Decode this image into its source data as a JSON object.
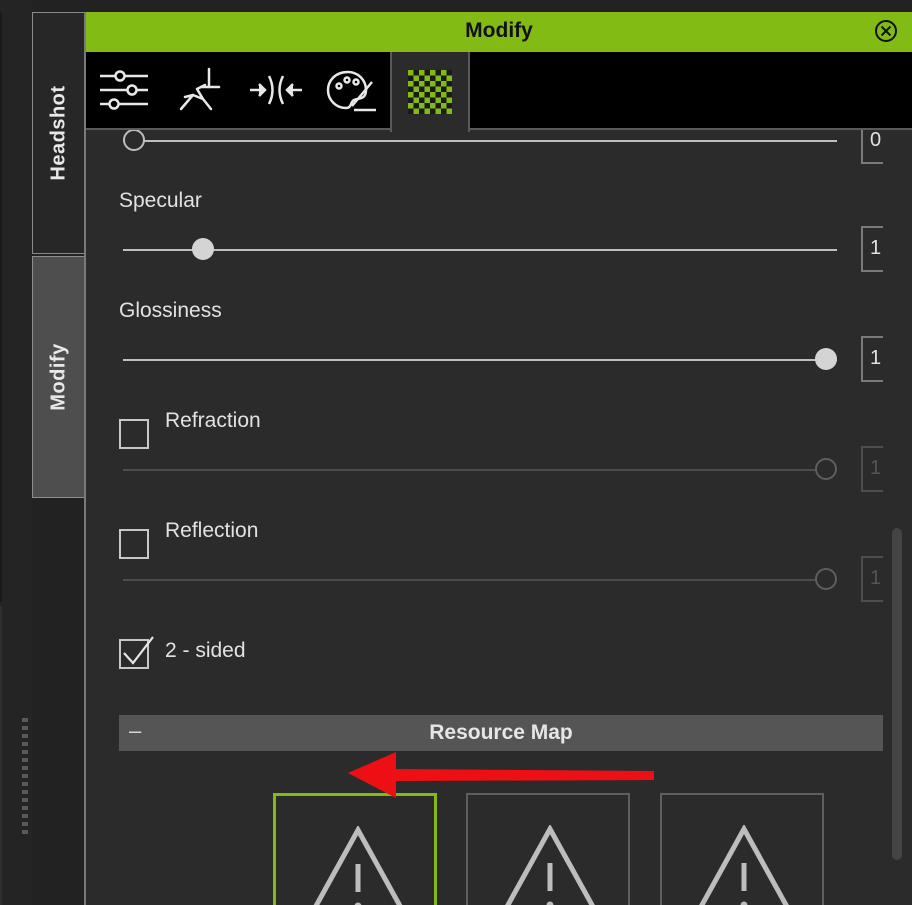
{
  "side_tabs": [
    "Headshot",
    "Modify"
  ],
  "panel": {
    "title": "Modify",
    "toolbar_icons": [
      "sliders-icon",
      "running-figure-icon",
      "compress-icon",
      "palette-icon",
      "checker-texture-icon"
    ]
  },
  "properties": {
    "top_slider_value": "0",
    "specular": {
      "label": "Specular",
      "value": "1"
    },
    "glossiness": {
      "label": "Glossiness",
      "value": "1"
    },
    "refraction": {
      "label": "Refraction",
      "value": "1",
      "checked": false
    },
    "reflection": {
      "label": "Reflection",
      "value": "1",
      "checked": false
    },
    "two_sided": {
      "label": "2 - sided",
      "checked": true
    }
  },
  "resource_map": {
    "collapse_symbol": "–",
    "title": "Resource Map"
  },
  "colors": {
    "accent": "#82bb14",
    "annotation_arrow": "#ee0f14"
  }
}
